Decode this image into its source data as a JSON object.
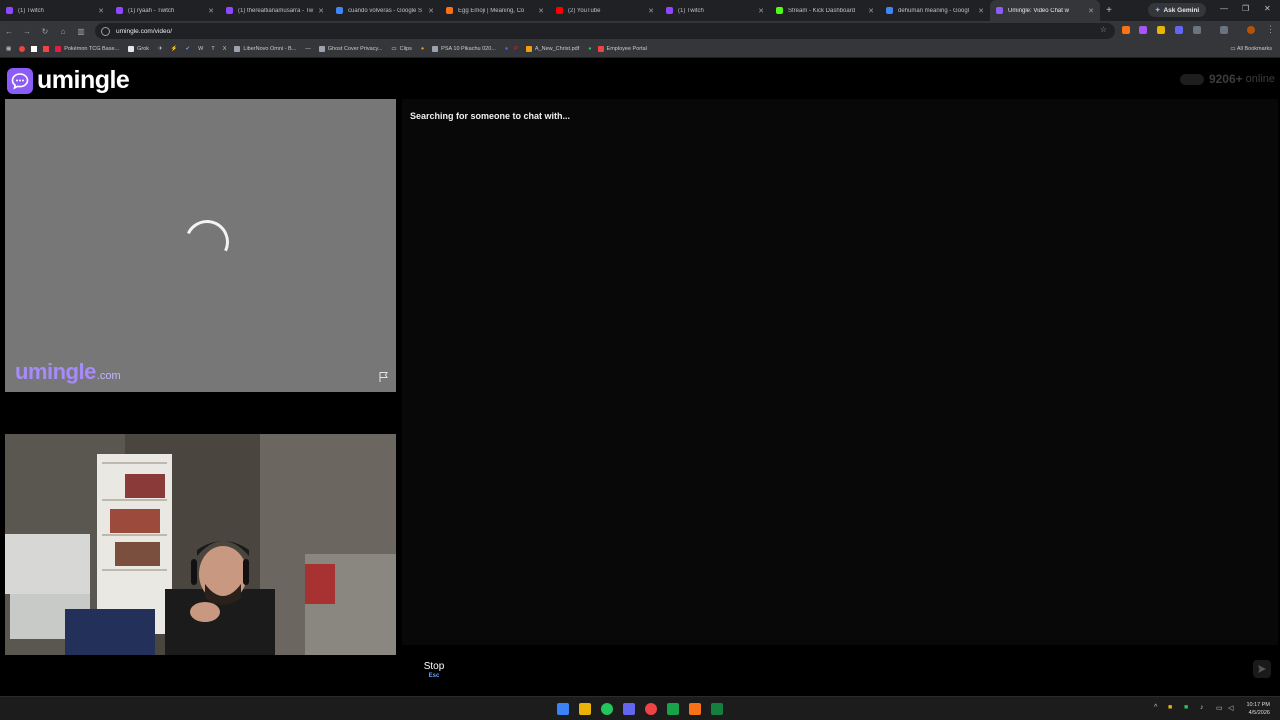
{
  "browser": {
    "tabs": [
      {
        "label": "(1) Twitch",
        "color": "#9146ff"
      },
      {
        "label": "(1) ryaah - Twitch",
        "color": "#9146ff"
      },
      {
        "label": "(1) therealtianamusarra - Tw",
        "color": "#9146ff"
      },
      {
        "label": "cuando volveras - Google S",
        "color": "#4285f4"
      },
      {
        "label": "Egg Emoji | Meaning, Co",
        "color": "#f97316"
      },
      {
        "label": "(2) YouTube",
        "color": "#ff0000"
      },
      {
        "label": "(1) Twitch",
        "color": "#9146ff"
      },
      {
        "label": "Stream - Kick Dashboard",
        "color": "#53fc18"
      },
      {
        "label": "dehuman meaning - Googl",
        "color": "#4285f4"
      },
      {
        "label": "Umingle: Video Chat w",
        "color": "#8b5cf6"
      }
    ],
    "gemini_label": "Ask Gemini",
    "url": "umingle.com/video/",
    "bookmarks": [
      {
        "label": "Pokémon TCG Base...",
        "color": "#e11d48"
      },
      {
        "label": "Grok",
        "color": "#e5e7eb"
      },
      {
        "label": "LiberNovo Omni - B...",
        "color": "#9ca3af"
      },
      {
        "label": "Ghost Cover Privacy...",
        "color": "#9ca3af"
      },
      {
        "label": "Clips",
        "color": "#9ca3af"
      },
      {
        "label": "PSA 10 Pikachu 020...",
        "color": "#f59e0b"
      },
      {
        "label": "A_New_Christ.pdf",
        "color": "#ef4444"
      },
      {
        "label": "Employee Portal",
        "color": "#3b82f6"
      }
    ],
    "all_bookmarks_label": "All Bookmarks"
  },
  "site": {
    "logo_text": "umingle",
    "online_count": "9206+",
    "online_suffix": "online",
    "watermark_main": "umingle",
    "watermark_suffix": ".com",
    "status_text": "Searching for someone to chat with...",
    "stop_label": "Stop",
    "stop_shortcut": "Esc",
    "message_value": ""
  },
  "taskbar": {
    "time": "10:17 PM",
    "date": "4/5/2026"
  },
  "colors": {
    "brand": "#8b5cf6",
    "accent_blue": "#60a5fa"
  }
}
